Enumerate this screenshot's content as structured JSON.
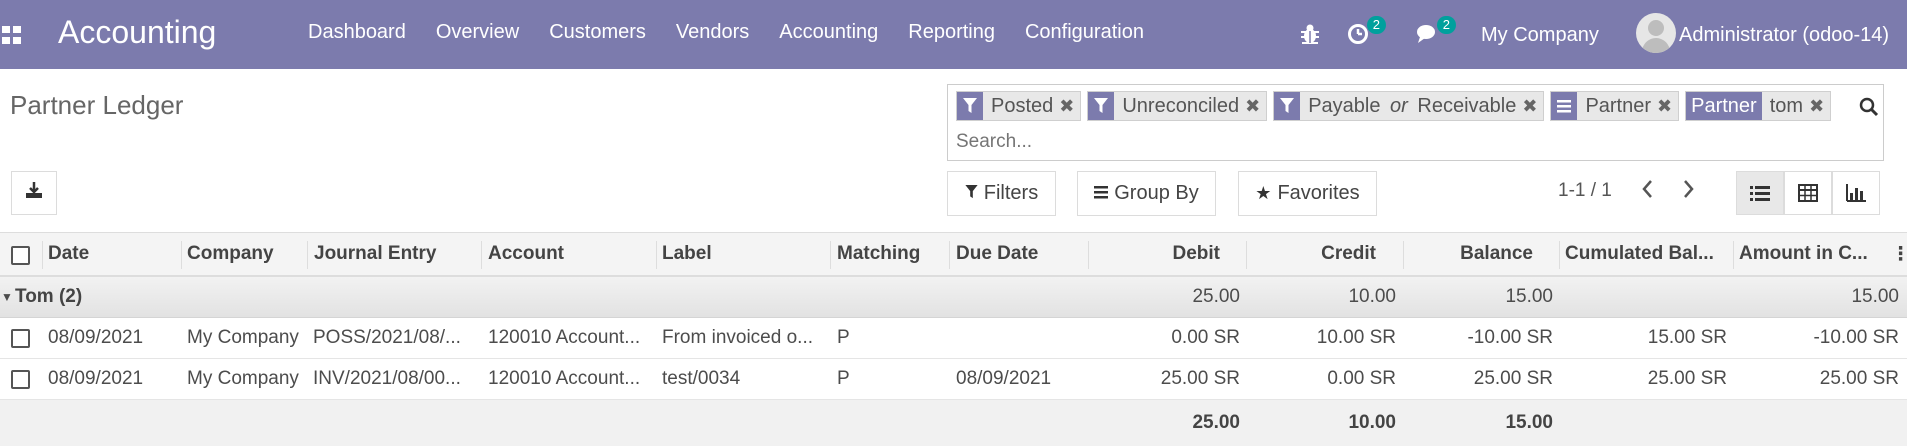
{
  "app": {
    "title": "Accounting"
  },
  "menu": [
    "Dashboard",
    "Overview",
    "Customers",
    "Vendors",
    "Accounting",
    "Reporting",
    "Configuration"
  ],
  "systray": {
    "activity_count": "2",
    "messages_count": "2",
    "company": "My Company",
    "user": "Administrator (odoo-14)"
  },
  "page": {
    "title": "Partner Ledger"
  },
  "search": {
    "facets": [
      {
        "type": "filter",
        "value": "Posted"
      },
      {
        "type": "filter",
        "value": "Unreconciled"
      },
      {
        "type": "filter",
        "value_pre": "Payable ",
        "value_em": "or",
        "value_post": " Receivable"
      },
      {
        "type": "groupby",
        "value": "Partner"
      },
      {
        "type": "field",
        "label": "Partner",
        "value": "tom"
      }
    ],
    "placeholder": "Search..."
  },
  "controls": {
    "filters": "Filters",
    "group_by": "Group By",
    "favorites": "Favorites",
    "pager": "1-1 / 1"
  },
  "table": {
    "headers": {
      "date": "Date",
      "company": "Company",
      "journal_entry": "Journal Entry",
      "account": "Account",
      "label": "Label",
      "matching": "Matching",
      "due_date": "Due Date",
      "debit": "Debit",
      "credit": "Credit",
      "balance": "Balance",
      "cumulated": "Cumulated Bal...",
      "amount_currency": "Amount in C..."
    },
    "group": {
      "name": "Tom (2)",
      "debit": "25.00",
      "credit": "10.00",
      "balance": "15.00",
      "amount_currency": "15.00"
    },
    "rows": [
      {
        "date": "08/09/2021",
        "company": "My Company",
        "journal_entry": "POSS/2021/08/...",
        "account": "120010 Account...",
        "label": "From invoiced o...",
        "matching": "P",
        "due_date": "",
        "debit": "0.00 SR",
        "credit": "10.00 SR",
        "balance": "-10.00 SR",
        "cumulated": "15.00 SR",
        "amount_currency": "-10.00 SR"
      },
      {
        "date": "08/09/2021",
        "company": "My Company",
        "journal_entry": "INV/2021/08/00...",
        "account": "120010 Account...",
        "label": "test/0034",
        "matching": "P",
        "due_date": "08/09/2021",
        "debit": "25.00 SR",
        "credit": "0.00 SR",
        "balance": "25.00 SR",
        "cumulated": "25.00 SR",
        "amount_currency": "25.00 SR"
      }
    ],
    "totals": {
      "debit": "25.00",
      "credit": "10.00",
      "balance": "15.00"
    }
  },
  "colors": {
    "navbar": "#7c7bad",
    "badge": "#00a09d"
  }
}
